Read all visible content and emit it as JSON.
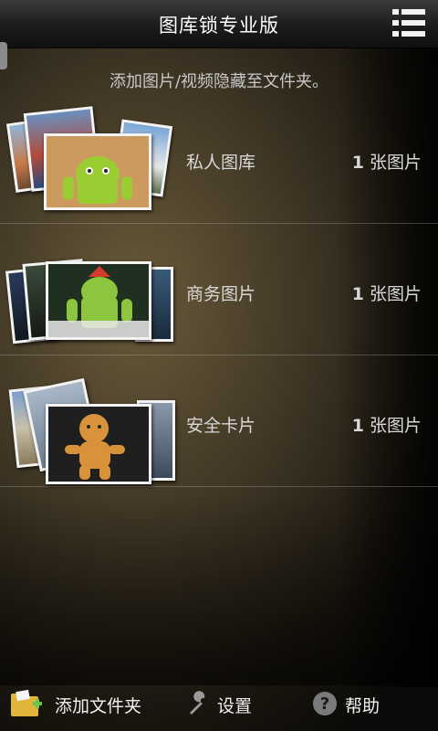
{
  "header": {
    "title": "图库锁专业版",
    "menu_icon": "list-menu-icon"
  },
  "hint": "添加图片/视频隐藏至文件夹。",
  "folders": [
    {
      "name": "私人图库",
      "count": "1",
      "unit": "张图片"
    },
    {
      "name": "商务图片",
      "count": "1",
      "unit": "张图片"
    },
    {
      "name": "安全卡片",
      "count": "1",
      "unit": "张图片"
    }
  ],
  "bottom_bar": {
    "add_folder": {
      "label": "添加文件夹",
      "icon": "add-folder-icon"
    },
    "settings": {
      "label": "设置",
      "icon": "wrench-icon"
    },
    "help": {
      "label": "帮助",
      "icon": "help-icon"
    }
  },
  "colors": {
    "accent_green": "#8cc63f",
    "text": "#d8d8d8",
    "divider": "#c8c8c8"
  }
}
